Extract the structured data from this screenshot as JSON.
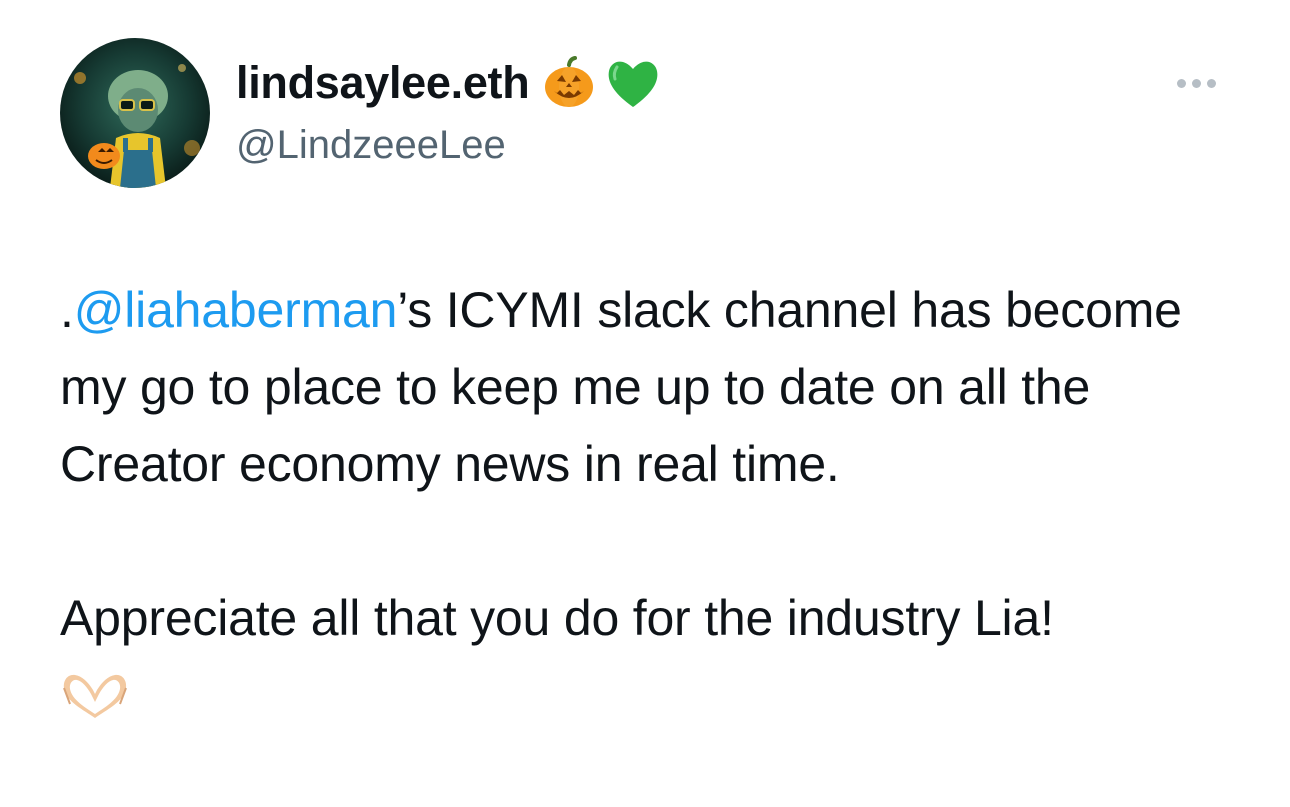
{
  "author": {
    "display_name": "lindsaylee.eth",
    "handle": "@LindzeeeLee",
    "name_emojis": [
      "jack-o-lantern-icon",
      "green-heart-icon"
    ]
  },
  "tweet": {
    "mention_prefix": ".",
    "mention": "@liahaberman",
    "line1_rest": "’s ICYMI slack channel has become my go to place to keep me up to date on all the Creator economy news in real time.",
    "line2": "Appreciate all that you do for the industry Lia!",
    "trailing_emoji": "heart-hands-icon"
  },
  "colors": {
    "text": "#0f1419",
    "secondary": "#536471",
    "link": "#1d9bf0"
  },
  "icons": {
    "more": "more-options-icon"
  }
}
